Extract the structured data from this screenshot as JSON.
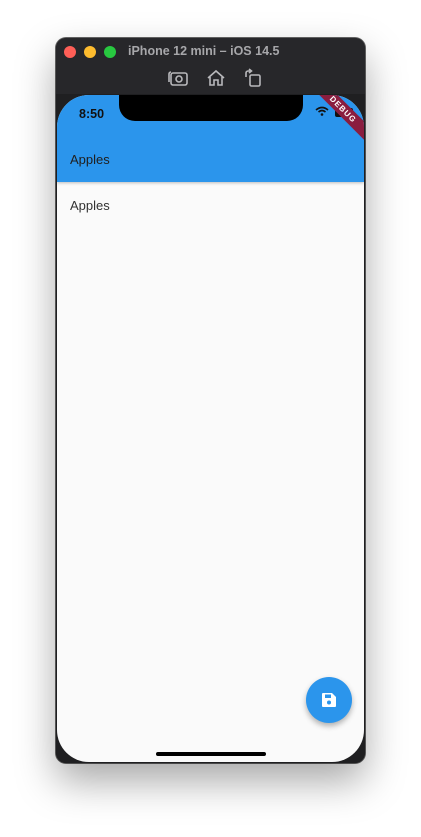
{
  "window": {
    "title": "iPhone 12 mini – iOS 14.5",
    "toolbar": {
      "screenshot_icon": "camera-icon",
      "home_icon": "home-icon",
      "rotate_icon": "rotate-icon"
    }
  },
  "status_bar": {
    "time": "8:50",
    "debug_label": "DEBUG"
  },
  "app_bar": {
    "title": "Apples",
    "color": "#2b95ec"
  },
  "body": {
    "text": "Apples"
  },
  "fab": {
    "icon": "save-icon",
    "color": "#2b95ec"
  }
}
